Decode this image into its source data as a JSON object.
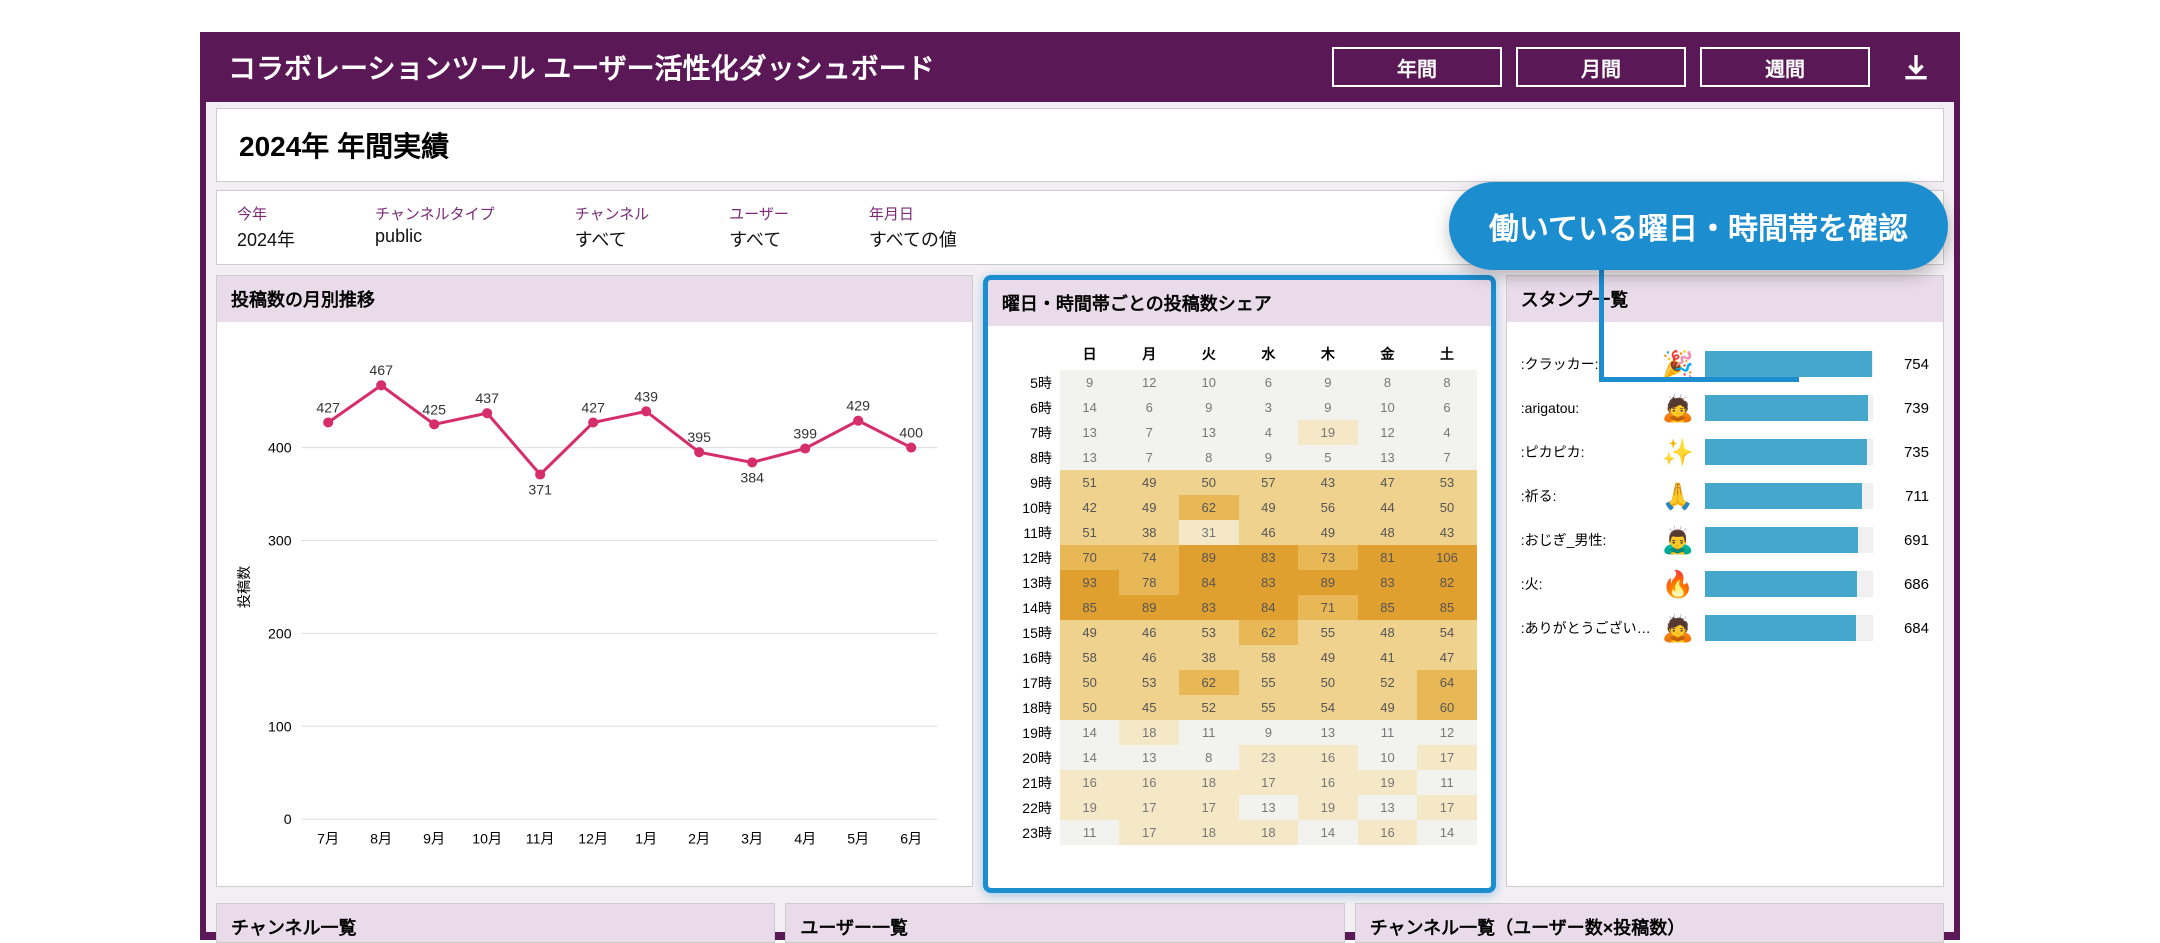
{
  "header": {
    "title": "コラボレーションツール ユーザー活性化ダッシュボード",
    "periods": [
      "年間",
      "月間",
      "週間"
    ]
  },
  "year_title": "2024年 年間実績",
  "filters": [
    {
      "label": "今年",
      "value": "2024年"
    },
    {
      "label": "チャンネルタイプ",
      "value": "public"
    },
    {
      "label": "チャンネル",
      "value": "すべて"
    },
    {
      "label": "ユーザー",
      "value": "すべて"
    },
    {
      "label": "年月日",
      "value": "すべての値"
    }
  ],
  "callout": "働いている曜日・時間帯を確認",
  "panels": {
    "line": "投稿数の月別推移",
    "heatmap": "曜日・時間帯ごとの投稿数シェア",
    "stamp": "スタンプ一覧"
  },
  "bottom_panels": [
    "チャンネル一覧",
    "ユーザー一覧",
    "チャンネル一覧（ユーザー数×投稿数）"
  ],
  "chart_data": [
    {
      "type": "line",
      "title": "投稿数の月別推移",
      "xlabel": "",
      "ylabel": "投稿数",
      "ylim": [
        0,
        500
      ],
      "categories": [
        "7月",
        "8月",
        "9月",
        "10月",
        "11月",
        "12月",
        "1月",
        "2月",
        "3月",
        "4月",
        "5月",
        "6月"
      ],
      "values": [
        427,
        467,
        425,
        437,
        371,
        427,
        439,
        395,
        384,
        399,
        429,
        400
      ]
    },
    {
      "type": "heatmap",
      "title": "曜日・時間帯ごとの投稿数シェア",
      "x_categories": [
        "日",
        "月",
        "火",
        "水",
        "木",
        "金",
        "土"
      ],
      "y_categories": [
        "5時",
        "6時",
        "7時",
        "8時",
        "9時",
        "10時",
        "11時",
        "12時",
        "13時",
        "14時",
        "15時",
        "16時",
        "17時",
        "18時",
        "19時",
        "20時",
        "21時",
        "22時",
        "23時"
      ],
      "grid": [
        [
          9,
          12,
          10,
          6,
          9,
          8,
          8
        ],
        [
          14,
          6,
          9,
          3,
          9,
          10,
          6
        ],
        [
          13,
          7,
          13,
          4,
          19,
          12,
          4
        ],
        [
          13,
          7,
          8,
          9,
          5,
          13,
          7
        ],
        [
          51,
          49,
          50,
          57,
          43,
          47,
          53
        ],
        [
          42,
          49,
          62,
          49,
          56,
          44,
          50
        ],
        [
          51,
          38,
          31,
          46,
          49,
          48,
          43
        ],
        [
          70,
          74,
          89,
          83,
          73,
          81,
          106
        ],
        [
          93,
          78,
          84,
          83,
          89,
          83,
          82
        ],
        [
          85,
          89,
          83,
          84,
          71,
          85,
          85
        ],
        [
          49,
          46,
          53,
          62,
          55,
          48,
          54
        ],
        [
          58,
          46,
          38,
          58,
          49,
          41,
          47
        ],
        [
          50,
          53,
          62,
          55,
          50,
          52,
          64
        ],
        [
          50,
          45,
          52,
          55,
          54,
          49,
          60
        ],
        [
          14,
          18,
          11,
          9,
          13,
          11,
          12
        ],
        [
          14,
          13,
          8,
          23,
          16,
          10,
          17
        ],
        [
          16,
          16,
          18,
          17,
          16,
          19,
          11
        ],
        [
          19,
          17,
          17,
          13,
          19,
          13,
          17
        ],
        [
          11,
          17,
          18,
          18,
          14,
          16,
          14
        ]
      ]
    },
    {
      "type": "bar",
      "title": "スタンプ一覧",
      "categories": [
        ":クラッカー:",
        ":arigatou:",
        ":ピカピカ:",
        ":祈る:",
        ":おじぎ_男性:",
        ":火:",
        ":ありがとうございます:"
      ],
      "values": [
        754,
        739,
        735,
        711,
        691,
        686,
        684
      ],
      "emoji": [
        "🎉",
        "🙇",
        "✨",
        "🙏",
        "🙇‍♂️",
        "🔥",
        "🙇"
      ],
      "xlim": [
        0,
        760
      ]
    }
  ]
}
